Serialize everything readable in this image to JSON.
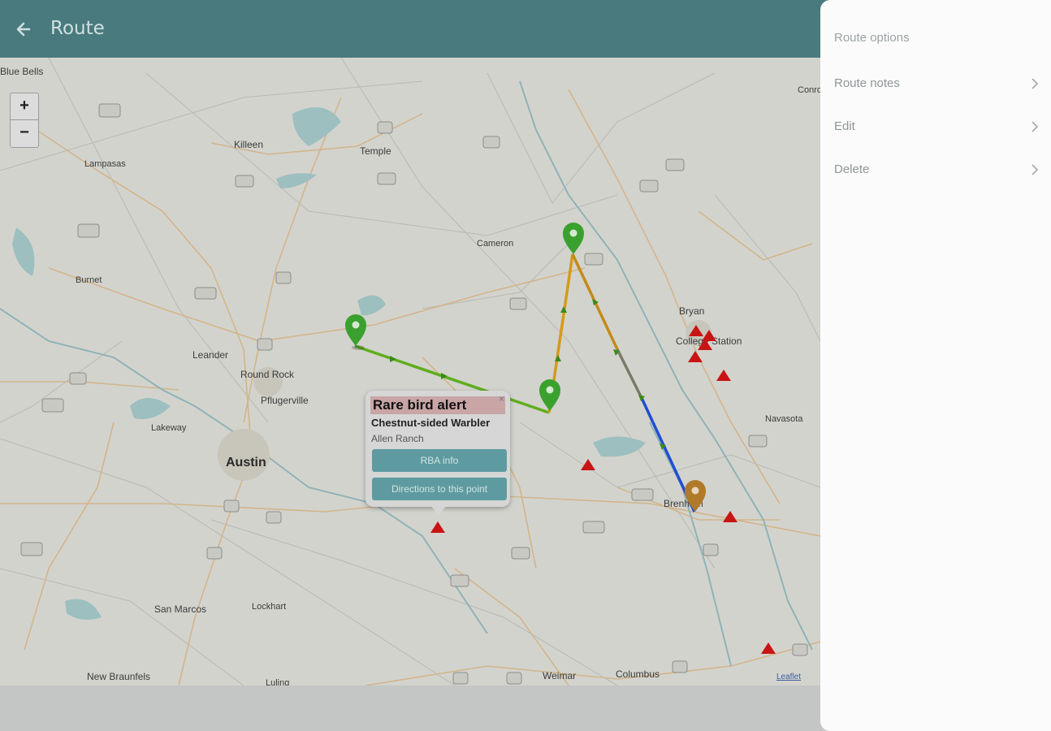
{
  "appbar": {
    "title": "Route",
    "back_icon": "arrow-left-icon",
    "bg": "#497a7d"
  },
  "map": {
    "labels": [
      {
        "id": "blue-bells",
        "text": "Blue Bells"
      },
      {
        "id": "killeen",
        "text": "Killeen"
      },
      {
        "id": "temple",
        "text": "Temple"
      },
      {
        "id": "lampasas",
        "text": "Lampasas"
      },
      {
        "id": "cameron",
        "text": "Cameron"
      },
      {
        "id": "burnet",
        "text": "Burnet"
      },
      {
        "id": "leander",
        "text": "Leander"
      },
      {
        "id": "round-rock",
        "text": "Round Rock"
      },
      {
        "id": "pflugerville",
        "text": "Pflugerville"
      },
      {
        "id": "lakeway",
        "text": "Lakeway"
      },
      {
        "id": "austin",
        "text": "Austin"
      },
      {
        "id": "bryan",
        "text": "Bryan"
      },
      {
        "id": "college-station",
        "text": "College Station"
      },
      {
        "id": "navasota",
        "text": "Navasota"
      },
      {
        "id": "brenham",
        "text": "Brenham"
      },
      {
        "id": "san-marcos",
        "text": "San Marcos"
      },
      {
        "id": "lockhart",
        "text": "Lockhart"
      },
      {
        "id": "new-braunfels",
        "text": "New Braunfels"
      },
      {
        "id": "weimar",
        "text": "Weimar"
      },
      {
        "id": "columbus",
        "text": "Columbus"
      },
      {
        "id": "luling",
        "text": "Luling"
      },
      {
        "id": "conroe",
        "text": "Conro"
      }
    ],
    "zoom_in": "+",
    "zoom_out": "−",
    "attribution": "Leaflet",
    "route_colors": [
      "#5fae1e",
      "#d49a1a",
      "#1f4fd1"
    ],
    "marker_colors": {
      "green": "#3aa12e",
      "end": "#b07a2a",
      "alert": "#c81414"
    }
  },
  "popup": {
    "heading": "Rare bird alert",
    "close": "×",
    "species": "Chestnut-sided Warbler",
    "location": "Allen Ranch",
    "info_button": "RBA info",
    "directions_button": "Directions to this point"
  },
  "panel": {
    "header": "Route options",
    "items": [
      {
        "label": "Route notes"
      },
      {
        "label": "Edit"
      },
      {
        "label": "Delete"
      }
    ]
  }
}
